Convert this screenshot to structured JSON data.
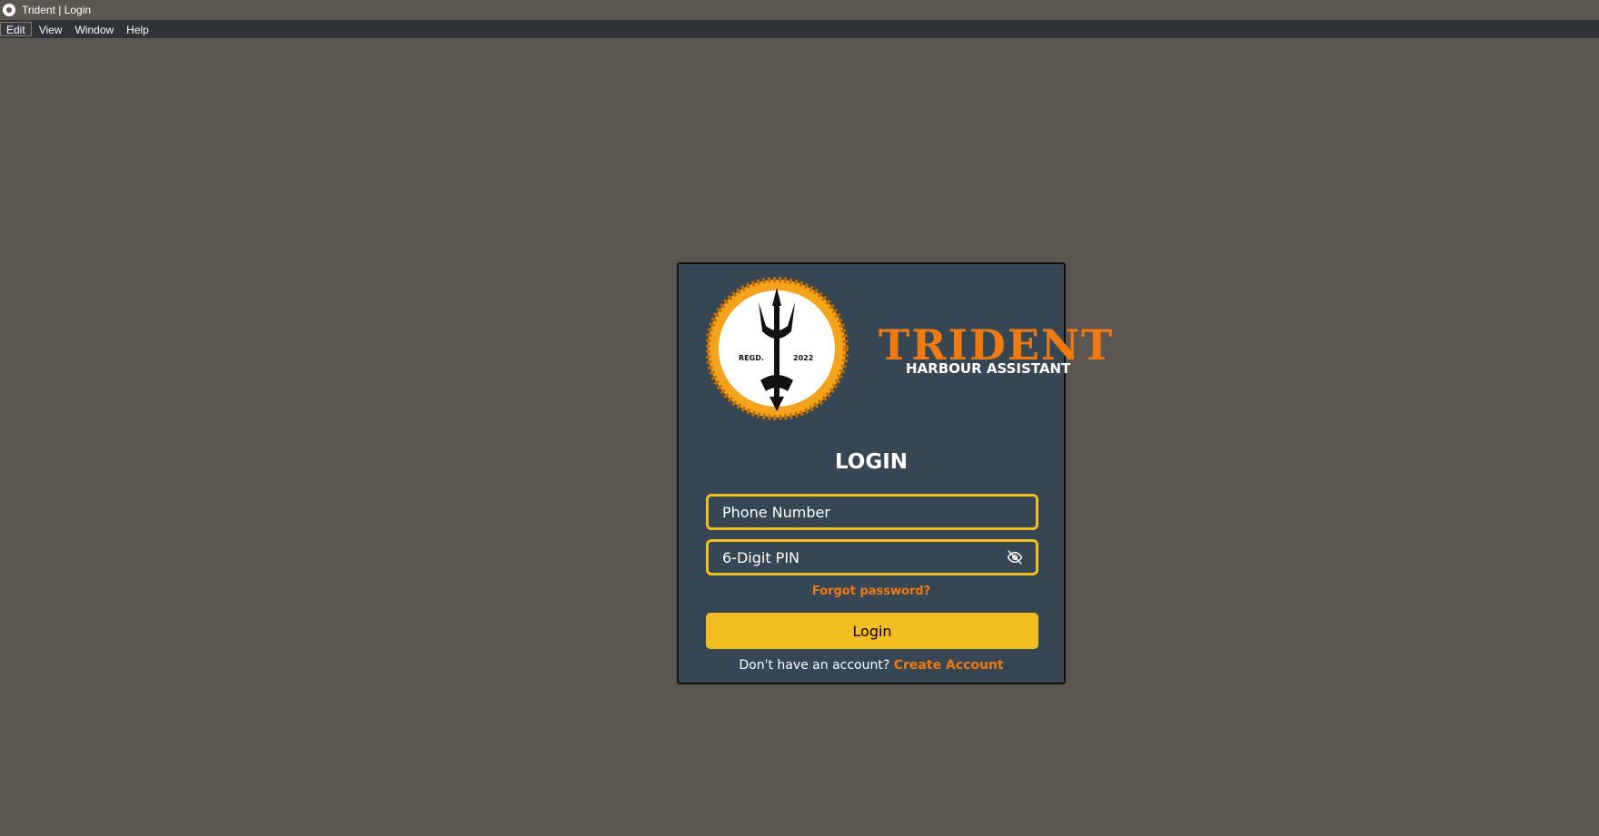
{
  "window": {
    "title": "Trident | Login"
  },
  "menubar": {
    "items": [
      {
        "label": "Edit",
        "active": true
      },
      {
        "label": "View"
      },
      {
        "label": "Window"
      },
      {
        "label": "Help"
      }
    ]
  },
  "logo": {
    "seal_left": "REGD.",
    "seal_right": "2022",
    "wordmark": "TRIDENT",
    "tagline": "HARBOUR ASSISTANT"
  },
  "login": {
    "title": "LOGIN",
    "phone_placeholder": "Phone Number",
    "pin_placeholder": "6-Digit PIN",
    "toggle_icon": "eye-off-icon",
    "forgot_label": "Forgot password?",
    "login_button": "Login",
    "no_account_text": "Don't have an account?",
    "create_account_label": "Create Account"
  },
  "colors": {
    "background": "#5b5750",
    "card": "#374653",
    "accent_orange": "#f07a12",
    "accent_yellow": "#f1bd21"
  }
}
